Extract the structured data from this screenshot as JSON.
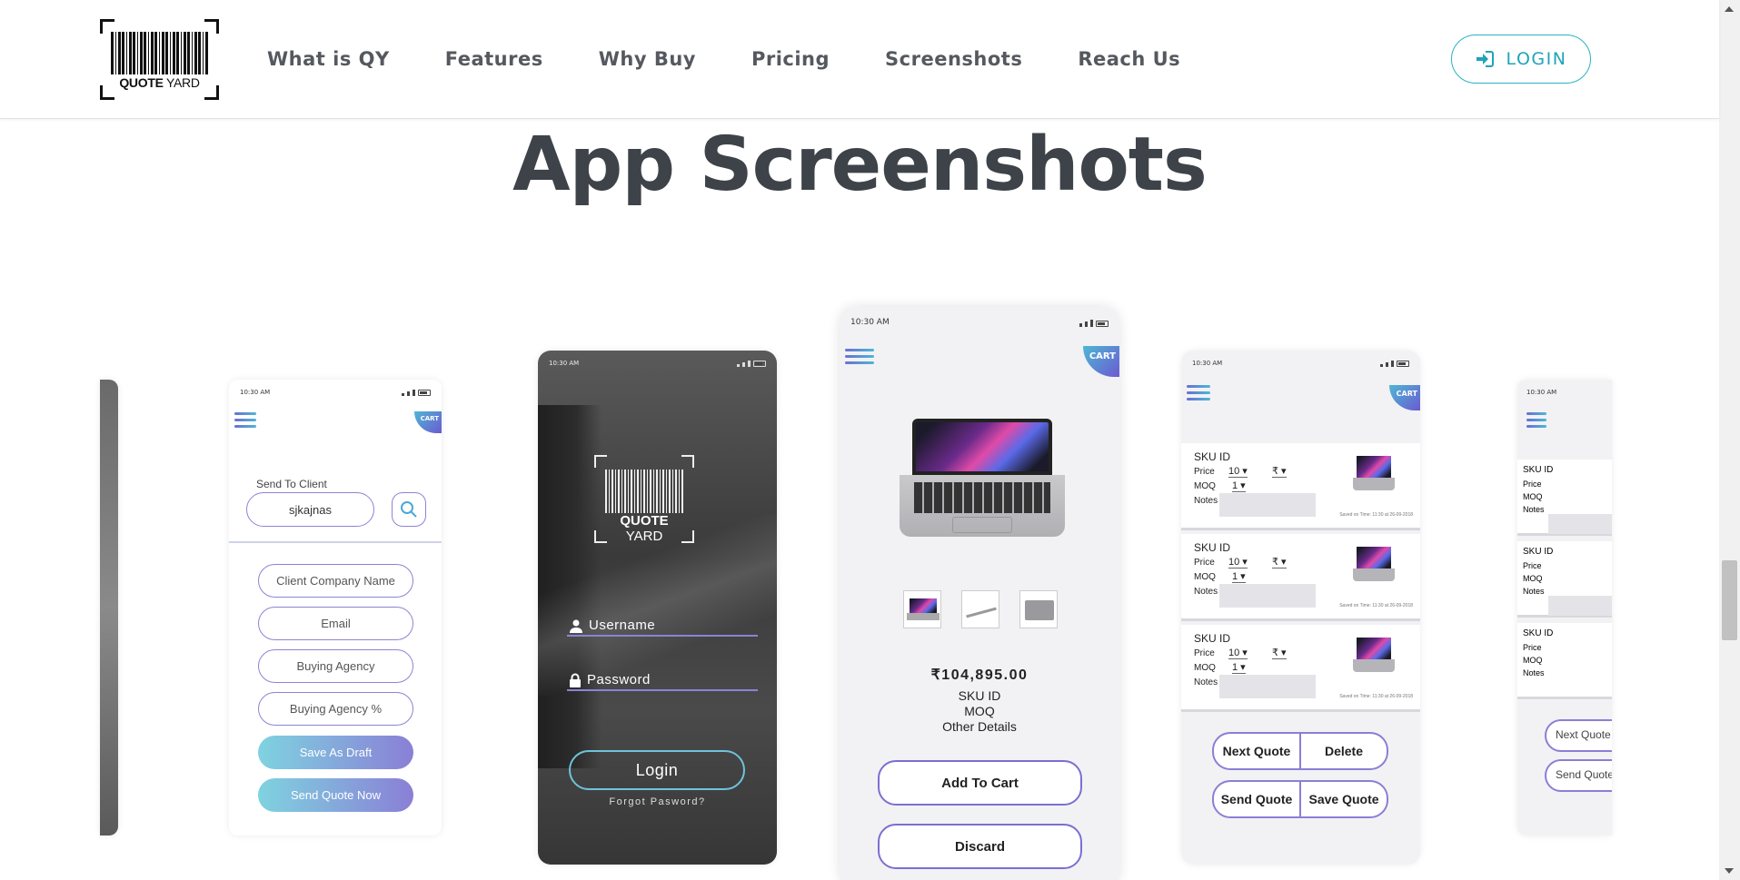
{
  "brand": {
    "logo_word_bold": "QUOTE",
    "logo_word_light": "YARD"
  },
  "nav": {
    "items": [
      "What is QY",
      "Features",
      "Why Buy",
      "Pricing",
      "Screenshots",
      "Reach Us"
    ],
    "login_label": "LOGIN"
  },
  "section": {
    "title": "App Screenshots"
  },
  "status_time": "10:30 AM",
  "cart_label": "CART",
  "screen_send": {
    "label": "Send To Client",
    "client_value": "sjkajnas",
    "fields": [
      "Client Company Name",
      "Email",
      "Buying Agency",
      "Buying Agency %"
    ],
    "save_draft": "Save As Draft",
    "send_now": "Send Quote Now"
  },
  "screen_login": {
    "logo_bold": "QUOTE",
    "logo_light": "YARD",
    "username": "Username",
    "password": "Password",
    "login": "Login",
    "forgot": "Forgot Pasword?"
  },
  "screen_product": {
    "price": "₹104,895.00",
    "sku": "SKU ID",
    "moq": "MOQ",
    "other": "Other Details",
    "add_to_cart": "Add To Cart",
    "discard": "Discard"
  },
  "screen_quotes": {
    "sku": "SKU ID",
    "price_label": "Price",
    "moq_label": "MOQ",
    "notes_label": "Notes",
    "price_value": "10",
    "currency": "₹",
    "moq_value": "1",
    "saved": "Saved on Time: 11:30 at 26-09-2018",
    "next_quote": "Next Quote",
    "delete": "Delete",
    "send_quote": "Send Quote",
    "save_quote": "Save Quote"
  },
  "screen_right": {
    "next_quote": "Next Quote",
    "send_quote": "Send Quote"
  }
}
